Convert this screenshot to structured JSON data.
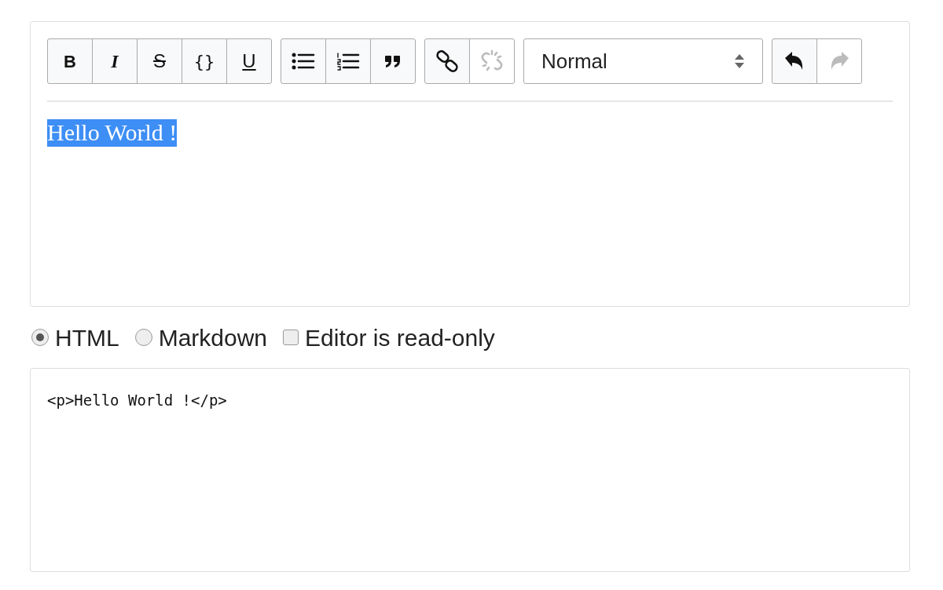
{
  "toolbar": [
    {
      "buttons": [
        {
          "kind": "bold",
          "label": "B",
          "disabled": false
        },
        {
          "kind": "italic",
          "label": "I",
          "disabled": false
        },
        {
          "kind": "strike",
          "label": "S",
          "disabled": false
        },
        {
          "kind": "code",
          "label": "{}",
          "disabled": false
        },
        {
          "kind": "underline",
          "label": "U",
          "disabled": false
        }
      ]
    },
    {
      "buttons": [
        {
          "kind": "bullet-list",
          "disabled": false
        },
        {
          "kind": "ordered-list",
          "disabled": false
        },
        {
          "kind": "quote",
          "disabled": false
        }
      ]
    },
    {
      "buttons": [
        {
          "kind": "link",
          "disabled": false
        },
        {
          "kind": "unlink",
          "disabled": true
        }
      ]
    },
    {
      "select": "Normal"
    },
    {
      "buttons": [
        {
          "kind": "undo",
          "disabled": false
        },
        {
          "kind": "redo",
          "disabled": true
        }
      ]
    }
  ],
  "editor": {
    "text": "Hello World !",
    "selected": true
  },
  "options": [
    {
      "kind": "radio",
      "label": "HTML",
      "selected": true
    },
    {
      "kind": "radio",
      "label": "Markdown",
      "selected": false
    },
    {
      "kind": "checkbox",
      "label": "Editor is read-only",
      "checked": false
    }
  ],
  "output": "<p>Hello World !</p>"
}
